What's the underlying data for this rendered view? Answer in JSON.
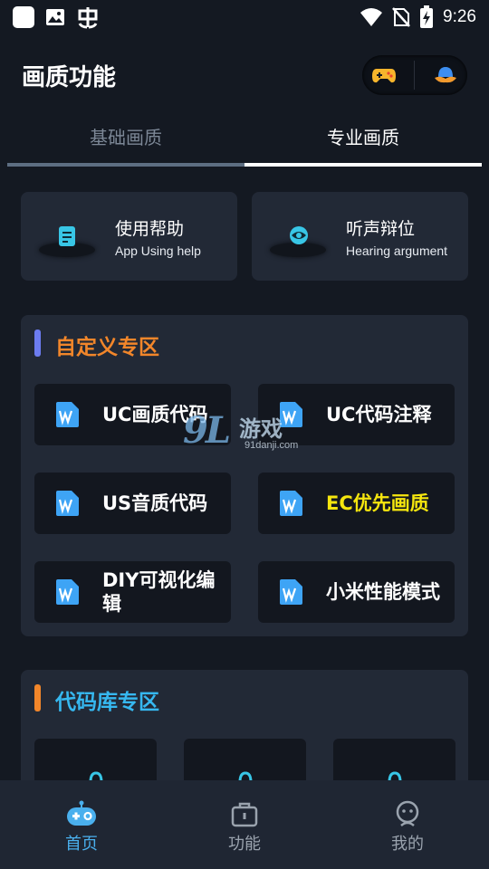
{
  "status_bar": {
    "time": "9:26",
    "left_icons": [
      "notification-square-icon",
      "image-icon",
      "bug-icon"
    ],
    "right_icons": [
      "wifi-icon",
      "no-sim-icon",
      "battery-charging-icon"
    ]
  },
  "header": {
    "title": "画质功能",
    "pill_icons": [
      "gamepad-icon",
      "cloud-bell-icon"
    ]
  },
  "tabs": [
    {
      "label": "基础画质",
      "selected": false
    },
    {
      "label": "专业画质",
      "selected": true
    }
  ],
  "help_cards": [
    {
      "title": "使用帮助",
      "subtitle": "App Using help",
      "icon": "help-document-icon"
    },
    {
      "title": "听声辩位",
      "subtitle": "Hearing argument",
      "icon": "sound-globe-icon"
    }
  ],
  "custom_section": {
    "title": "自定义专区",
    "accent_bar_color": "#6c7cf0",
    "title_color": "#f2862a",
    "buttons": [
      {
        "label": "UC画质代码",
        "color": "#ffffff"
      },
      {
        "label": "UC代码注释",
        "color": "#ffffff"
      },
      {
        "label": "US音质代码",
        "color": "#ffffff"
      },
      {
        "label": "EC优先画质",
        "color": "#f5e60e"
      },
      {
        "label": "DIY可视化编辑",
        "color": "#ffffff"
      },
      {
        "label": "小米性能模式",
        "color": "#ffffff"
      }
    ],
    "button_icon": "wps-document-icon"
  },
  "watermark": {
    "logo_number": "9L",
    "logo_text": "游戏",
    "domain": "91danji.com"
  },
  "codelib_section": {
    "title": "代码库专区",
    "accent_bar_color": "#f2862a",
    "title_color": "#36b8f0",
    "card_count": 3
  },
  "bottom_nav": [
    {
      "label": "首页",
      "icon": "robot-home-icon",
      "active": true
    },
    {
      "label": "功能",
      "icon": "toolbox-icon",
      "active": false
    },
    {
      "label": "我的",
      "icon": "user-face-icon",
      "active": false
    }
  ],
  "colors": {
    "background": "#141922",
    "card": "#222936",
    "button": "#13171f",
    "nav_active": "#4ab0ee",
    "nav_inactive": "#9aa3ae"
  }
}
